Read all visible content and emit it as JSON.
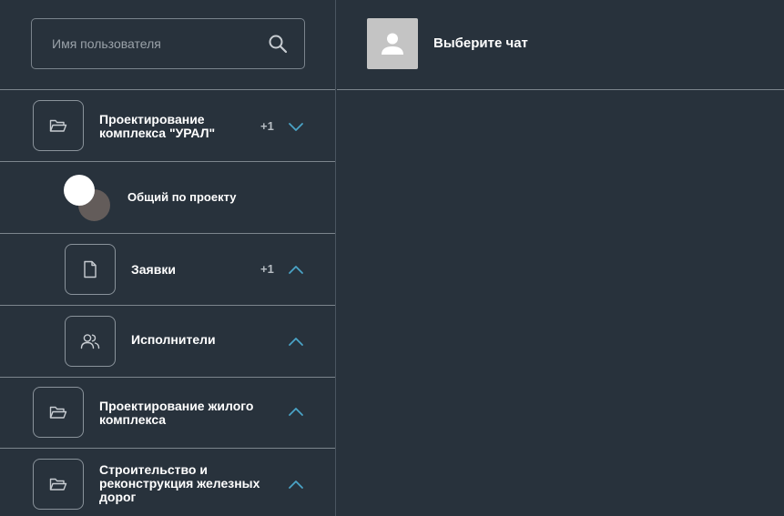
{
  "search": {
    "placeholder": "Имя пользователя"
  },
  "chat": {
    "title": "Выберите чат"
  },
  "sidebar": {
    "items": [
      {
        "title_line1": "Проектирование",
        "title_line2": "комплекса \"УРАЛ\"",
        "badge": "+1",
        "chevron": "down",
        "icon": "folder-open-icon"
      },
      {
        "title": "Общий по проекту",
        "icon": "avatar-stack"
      },
      {
        "title": "Заявки",
        "badge": "+1",
        "chevron": "up",
        "icon": "document-icon"
      },
      {
        "title": "Исполнители",
        "chevron": "up",
        "icon": "users-icon"
      },
      {
        "title_line1": "Проектирование жилого",
        "title_line2": "комплекса",
        "chevron": "up",
        "icon": "folder-open-icon"
      },
      {
        "title_line1": "Строительство и",
        "title_line2": "реконструкция железных",
        "title_line3": "дорог",
        "chevron": "up",
        "icon": "folder-open-icon"
      }
    ]
  },
  "colors": {
    "background": "#28323c",
    "border": "#7c858d",
    "chevron": "#4aa3c6",
    "badge": "#b7bdc3"
  }
}
